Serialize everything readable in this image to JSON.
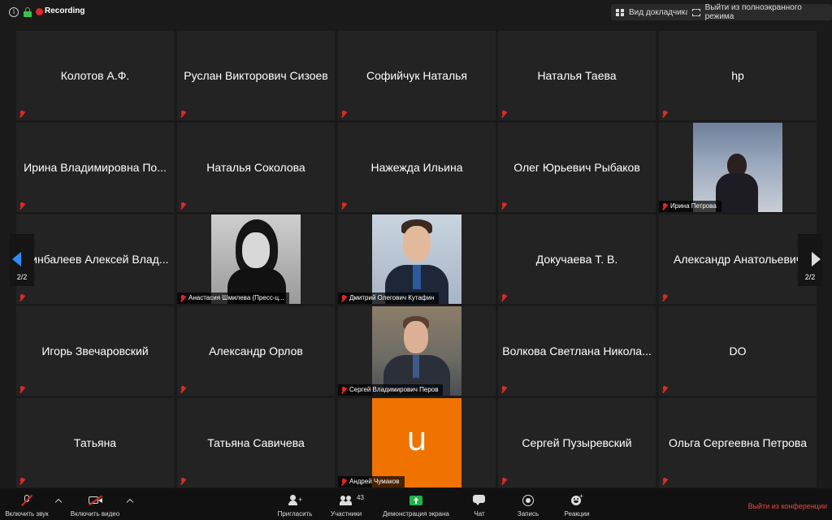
{
  "topbar": {
    "recording_label": "Recording",
    "speaker_view_label": "Вид докладчика",
    "exit_fullscreen_label": "Выйти из полноэкранного режима"
  },
  "pager": {
    "left_label": "2/2",
    "right_label": "2/2"
  },
  "participants": [
    {
      "name": "Колотов А.Ф.",
      "video": false
    },
    {
      "name": "Руслан Викторович Сизоев",
      "video": false
    },
    {
      "name": "Софийчук Наталья",
      "video": false
    },
    {
      "name": "Наталья Таева",
      "video": false
    },
    {
      "name": "hp",
      "video": false
    },
    {
      "name": "Ирина Владимировна По...",
      "video": false
    },
    {
      "name": "Наталья Соколова",
      "video": false
    },
    {
      "name": "Нажежда Ильина",
      "video": false
    },
    {
      "name": "Олег Юрьевич Рыбаков",
      "video": false
    },
    {
      "name": "Ирина Петрова",
      "video": true
    },
    {
      "name": "Минбалеев Алексей Влад...",
      "video": false
    },
    {
      "name": "Анастасия Шмилева (Пресс-ц...",
      "video": true
    },
    {
      "name": "Дмитрий Олегович Кутафин",
      "video": true
    },
    {
      "name": "Докучаева Т. В.",
      "video": false
    },
    {
      "name": "Александр Анатольевич",
      "video": false
    },
    {
      "name": "Игорь Звечаровский",
      "video": false
    },
    {
      "name": "Александр Орлов",
      "video": false
    },
    {
      "name": "Сергей Владимирович Перов",
      "video": true
    },
    {
      "name": "Волкова Светлана Никола...",
      "video": false
    },
    {
      "name": "DO",
      "video": false
    },
    {
      "name": "Татьяна",
      "video": false
    },
    {
      "name": "Татьяна Савичева",
      "video": false
    },
    {
      "name": "Андрей Чумаков",
      "video": true,
      "avatar_letter": "u",
      "avatar_color": "#f07300"
    },
    {
      "name": "Сергей Пузыревский",
      "video": false
    },
    {
      "name": "Ольга Сергеевна Петрова",
      "video": false
    }
  ],
  "toolbar": {
    "unmute_label": "Включить звук",
    "start_video_label": "Включить видео",
    "invite_label": "Пригласить",
    "participants_label": "Участники",
    "participants_count": "43",
    "share_label": "Демонстрация экрана",
    "chat_label": "Чат",
    "record_label": "Запись",
    "reactions_label": "Реакции",
    "leave_label": "Выйти из конференции"
  },
  "colors": {
    "accent_blue": "#2d8cff",
    "danger_red": "#e02828",
    "share_green": "#24b24a"
  }
}
